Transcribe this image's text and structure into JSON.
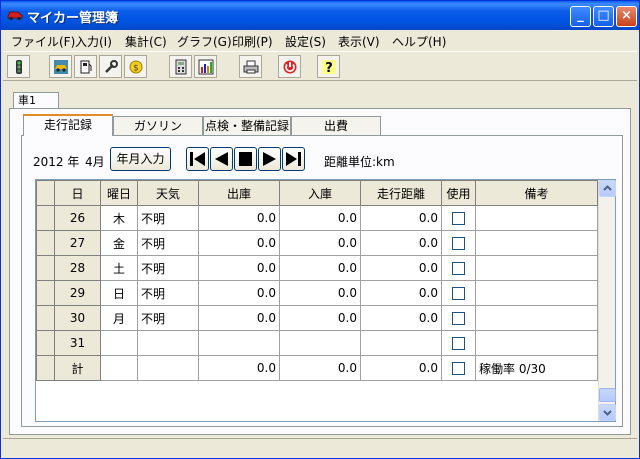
{
  "window": {
    "title": "マイカー管理簿"
  },
  "menu": [
    "ファイル(F)",
    "入力(I)",
    "集計(C)",
    "グラフ(G)",
    "印刷(P)",
    "設定(S)",
    "表示(V)",
    "ヘルプ(H)"
  ],
  "car_tab": "車1",
  "tabs": [
    "走行記録",
    "ガソリン",
    "点検・整備記録",
    "出費"
  ],
  "period": {
    "year": "2012 年",
    "month": "4月",
    "button": "年月入力",
    "unit": "距離単位:km"
  },
  "columns": [
    "日",
    "曜日",
    "天気",
    "出庫",
    "入庫",
    "走行距離",
    "使用",
    "備考"
  ],
  "rows": [
    {
      "day": "26",
      "weekday": "木",
      "weather": "不明",
      "out": "0.0",
      "in": "0.0",
      "distance": "0.0",
      "note": ""
    },
    {
      "day": "27",
      "weekday": "金",
      "weather": "不明",
      "out": "0.0",
      "in": "0.0",
      "distance": "0.0",
      "note": ""
    },
    {
      "day": "28",
      "weekday": "土",
      "weather": "不明",
      "out": "0.0",
      "in": "0.0",
      "distance": "0.0",
      "note": ""
    },
    {
      "day": "29",
      "weekday": "日",
      "weather": "不明",
      "out": "0.0",
      "in": "0.0",
      "distance": "0.0",
      "note": ""
    },
    {
      "day": "30",
      "weekday": "月",
      "weather": "不明",
      "out": "0.0",
      "in": "0.0",
      "distance": "0.0",
      "note": ""
    },
    {
      "day": "31",
      "weekday": "",
      "weather": "",
      "out": "",
      "in": "",
      "distance": "",
      "note": ""
    },
    {
      "day": "計",
      "weekday": "",
      "weather": "",
      "out": "0.0",
      "in": "0.0",
      "distance": "0.0",
      "note": "稼働率 0/30"
    }
  ],
  "icons": [
    "traffic-light-icon",
    "car-icon",
    "fuel-icon",
    "wrench-icon",
    "coin-icon",
    "calculator-icon",
    "chart-icon",
    "printer-icon",
    "power-icon",
    "help-icon"
  ]
}
